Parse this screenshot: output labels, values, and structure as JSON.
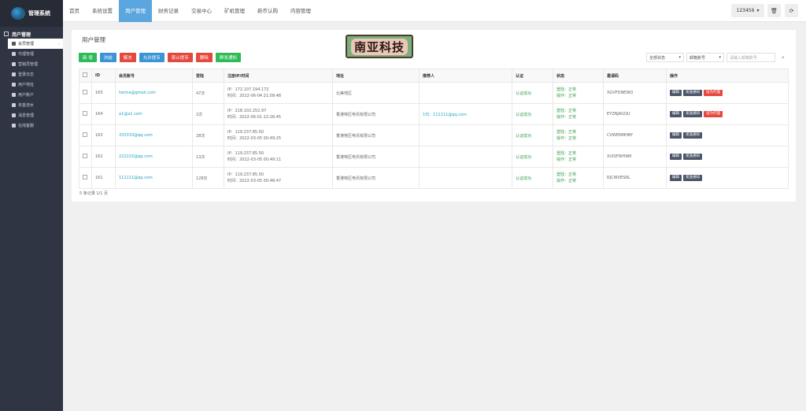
{
  "sidebar": {
    "logo_text": "管理系统",
    "group_label": "用户管理",
    "items": [
      {
        "label": "会员管理",
        "active": true
      },
      {
        "label": "代理管理"
      },
      {
        "label": "营销员管理"
      },
      {
        "label": "登录日志"
      },
      {
        "label": "用户地址"
      },
      {
        "label": "用户账户"
      },
      {
        "label": "资金流水"
      },
      {
        "label": "消息管理"
      },
      {
        "label": "在线客服"
      }
    ]
  },
  "topnav": {
    "items": [
      "首页",
      "系统设置",
      "用户管理",
      "财务记录",
      "交易中心",
      "矿机管理",
      "新币认购",
      "内容管理"
    ],
    "active_index": 2,
    "user_label": "123456"
  },
  "panel": {
    "title": "用户管理",
    "watermark": "南亚科技",
    "toolbar": [
      {
        "label": "新 增",
        "color": "#2ebb58"
      },
      {
        "label": "冻结",
        "color": "#3a94d6"
      },
      {
        "label": "解冻",
        "color": "#e5483d"
      },
      {
        "label": "允许提币",
        "color": "#3a94d6"
      },
      {
        "label": "禁止提币",
        "color": "#e5483d"
      },
      {
        "label": "删除",
        "color": "#e5483d"
      },
      {
        "label": "群发通知",
        "color": "#2ebb58"
      }
    ],
    "filters": {
      "status_select": "全部状态",
      "field_select": "邮箱账号",
      "search_placeholder": "请输入邮箱账号"
    },
    "columns": [
      "",
      "ID",
      "会员账号",
      "登陆",
      "注册IP/时间",
      "地址",
      "推荐人",
      "认证",
      "状态",
      "邀请码",
      "操作"
    ],
    "rows": [
      {
        "id": "165",
        "account": "heima@gmail.com",
        "logins": "47次",
        "ip": "IP：172.107.194.172",
        "time": "时间：2022-06-04 21:09:48",
        "address": "北美地区",
        "referrer": "",
        "auth": "认证成功",
        "status_login": "登陆：正常",
        "status_op": "操作：正常",
        "invite": "XGVFDNEWQ",
        "actions": [
          "编辑",
          "发送通知",
          "设为代理"
        ]
      },
      {
        "id": "164",
        "account": "a1@a1.com",
        "logins": "2次",
        "ip": "IP：218.102.252.97",
        "time": "时间：2022-06-01 22:26:45",
        "address": "香港特区电讯有限公司",
        "referrer": "1代：111111@qq.com",
        "auth": "认证成功",
        "status_login": "登陆：正常",
        "status_op": "操作：正常",
        "invite": "EYZNJAGQU",
        "actions": [
          "编辑",
          "发送通知",
          "设为代理"
        ]
      },
      {
        "id": "163",
        "account": "333333@qq.com",
        "logins": "28次",
        "ip": "IP：119.237.85.50",
        "time": "时间：2022-03-05 00:49:25",
        "address": "香港特区电讯有限公司",
        "referrer": "",
        "auth": "认证成功",
        "status_login": "登陆：正常",
        "status_op": "操作：正常",
        "invite": "CVWENMHBY",
        "actions": [
          "编辑",
          "发送通知"
        ]
      },
      {
        "id": "162",
        "account": "222222@qq.com",
        "logins": "13次",
        "ip": "IP：119.237.85.50",
        "time": "时间：2022-03-05 00:49:11",
        "address": "香港特区电讯有限公司",
        "referrer": "",
        "auth": "认证成功",
        "status_login": "登陆：正常",
        "status_op": "操作：正常",
        "invite": "XUISFWHNM",
        "actions": [
          "编辑",
          "发送通知"
        ]
      },
      {
        "id": "161",
        "account": "111111@qq.com",
        "logins": "128次",
        "ip": "IP：119.237.85.50",
        "time": "时间：2022-03-05 00:48:47",
        "address": "香港特区电讯有限公司",
        "referrer": "",
        "auth": "认证成功",
        "status_login": "登陆：正常",
        "status_op": "操作：正常",
        "invite": "RJCWVESNL",
        "actions": [
          "编辑",
          "发送通知"
        ]
      }
    ],
    "footer": "5 条记录 1/1 页"
  }
}
